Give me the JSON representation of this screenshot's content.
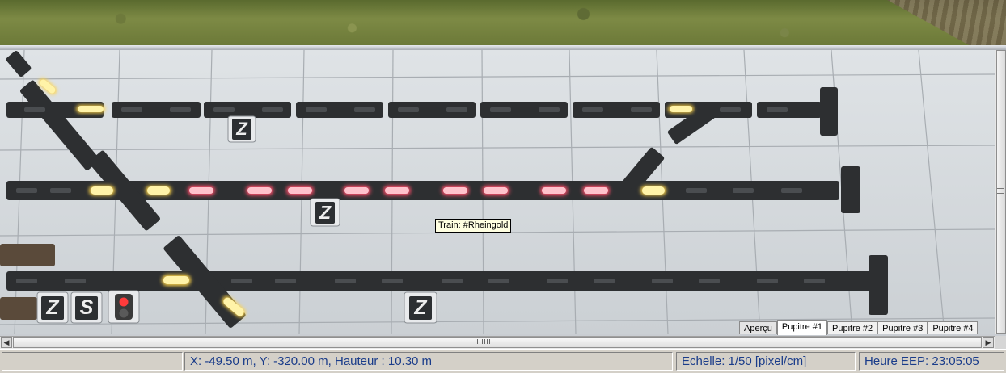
{
  "tooltip": {
    "text": "Train: #Rheingold"
  },
  "board": {
    "z_buttons": [
      "Z",
      "Z",
      "Z",
      "Z"
    ],
    "s_button": "S",
    "colors": {
      "occupied": "#ff4d6a",
      "route": "#ffd54a",
      "track": "#2d2f31",
      "tile": "#d4d9dd",
      "grid": "#a8adb2"
    }
  },
  "tabs": [
    {
      "label": "Aperçu",
      "active": false
    },
    {
      "label": "Pupitre #1",
      "active": true
    },
    {
      "label": "Pupitre #2",
      "active": false
    },
    {
      "label": "Pupitre #3",
      "active": false
    },
    {
      "label": "Pupitre #4",
      "active": false
    }
  ],
  "status": {
    "coords": "X: -49.50 m, Y: -320.00 m, Hauteur : 10.30 m",
    "scale": "Echelle: 1/50 [pixel/cm]",
    "time": "Heure EEP: 23:05:05"
  }
}
